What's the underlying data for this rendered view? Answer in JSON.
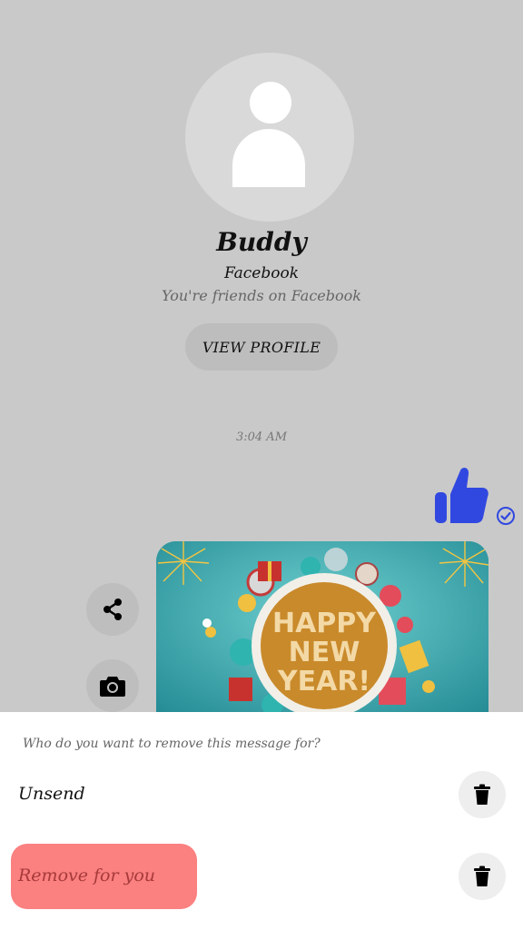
{
  "profile": {
    "name": "Buddy",
    "platform": "Facebook",
    "friends_note": "You're friends on Facebook",
    "view_profile_label": "VIEW PROFILE",
    "avatar_icon": "default-avatar-icon"
  },
  "conversation": {
    "timestamp": "3:04 AM",
    "sent_sticker": "thumbs-up-icon",
    "sent_status_icon": "check-circle-icon",
    "image_message": {
      "text": [
        "HAPPY",
        "NEW",
        "YEAR!"
      ]
    },
    "side_actions": [
      {
        "icon": "share-icon"
      },
      {
        "icon": "camera-icon"
      }
    ]
  },
  "remove_sheet": {
    "question": "Who do you want to remove this message for?",
    "options": [
      {
        "label": "Unsend",
        "icon": "trash-icon"
      },
      {
        "label": "Remove for you",
        "icon": "trash-icon",
        "highlighted": true
      }
    ]
  },
  "colors": {
    "background": "#c9c9c9",
    "accent_blue": "#3148e0",
    "highlight_red": "#fb8080",
    "card_teal": "#2f9ea6",
    "card_gold": "#c98a2b"
  }
}
